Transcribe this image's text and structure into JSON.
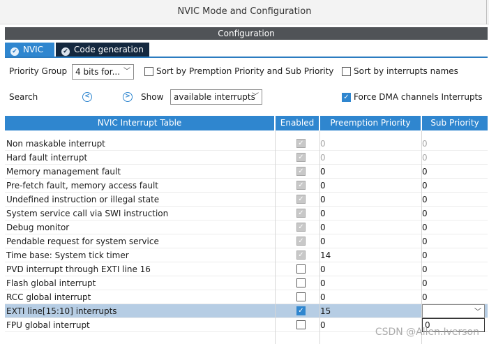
{
  "window": {
    "title": "NVIC Mode and Configuration"
  },
  "config": {
    "header": "Configuration"
  },
  "tabs": [
    {
      "label": "NVIC"
    },
    {
      "label": "Code generation"
    }
  ],
  "toolbar": {
    "priority_group_label": "Priority Group",
    "priority_group_value": "4 bits for...",
    "sort_premption_label": "Sort by Premption Priority and Sub Priority",
    "sort_names_label": "Sort by interrupts names",
    "search_label": "Search",
    "prev_icon": "chevron-left-circle-icon",
    "next_icon": "chevron-right-circle-icon",
    "show_label": "Show",
    "show_value": "available interrupts",
    "force_dma_label": "Force DMA channels Interrupts",
    "force_dma_checked": true
  },
  "table": {
    "headers": [
      "NVIC Interrupt Table",
      "Enabled",
      "Preemption Priority",
      "Sub Priority"
    ],
    "rows": [
      {
        "name": "Non maskable interrupt",
        "enabled": true,
        "locked": true,
        "preemption": "0",
        "sub": "0",
        "grayed": true
      },
      {
        "name": "Hard fault interrupt",
        "enabled": true,
        "locked": true,
        "preemption": "0",
        "sub": "0",
        "grayed": true
      },
      {
        "name": "Memory management fault",
        "enabled": true,
        "locked": true,
        "preemption": "0",
        "sub": "0"
      },
      {
        "name": "Pre-fetch fault, memory access fault",
        "enabled": true,
        "locked": true,
        "preemption": "0",
        "sub": "0"
      },
      {
        "name": "Undefined instruction or illegal state",
        "enabled": true,
        "locked": true,
        "preemption": "0",
        "sub": "0"
      },
      {
        "name": "System service call via SWI instruction",
        "enabled": true,
        "locked": true,
        "preemption": "0",
        "sub": "0"
      },
      {
        "name": "Debug monitor",
        "enabled": true,
        "locked": true,
        "preemption": "0",
        "sub": "0"
      },
      {
        "name": "Pendable request for system service",
        "enabled": true,
        "locked": true,
        "preemption": "0",
        "sub": "0"
      },
      {
        "name": "Time base: System tick timer",
        "enabled": true,
        "locked": true,
        "preemption": "14",
        "sub": "0"
      },
      {
        "name": "PVD interrupt through EXTI line 16",
        "enabled": false,
        "preemption": "0",
        "sub": "0"
      },
      {
        "name": "Flash global interrupt",
        "enabled": false,
        "preemption": "0",
        "sub": "0"
      },
      {
        "name": "RCC global interrupt",
        "enabled": false,
        "preemption": "0",
        "sub": "0"
      },
      {
        "name": "EXTI line[15:10] interrupts",
        "enabled": true,
        "preemption": "15",
        "sub": "",
        "selected": true
      },
      {
        "name": "FPU global interrupt",
        "enabled": false,
        "preemption": "0",
        "sub": "0",
        "editing": true
      }
    ]
  },
  "watermark": "CSDN @Allen.Iverson"
}
